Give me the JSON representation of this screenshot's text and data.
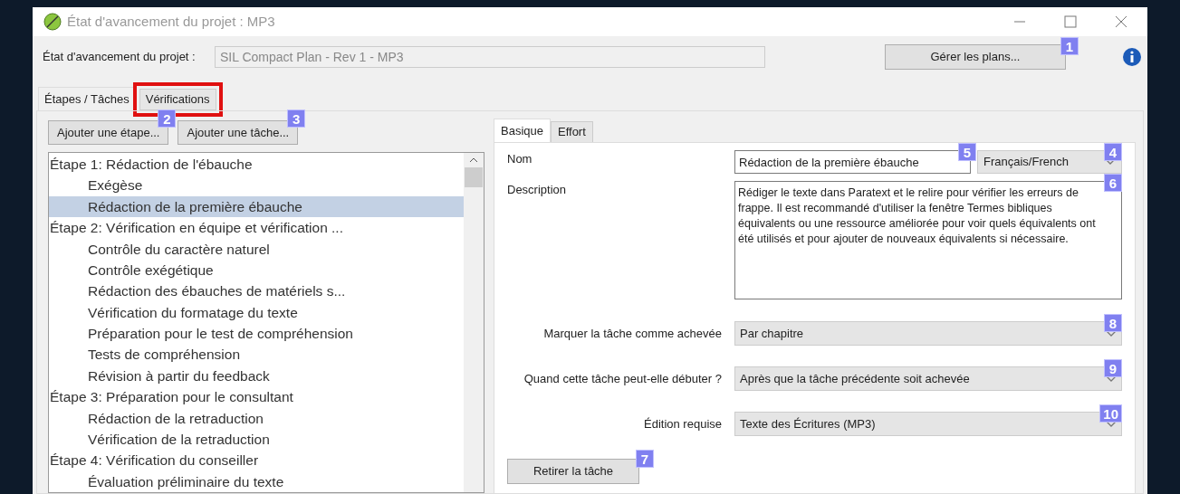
{
  "window": {
    "title": "État d'avancement du projet : MP3"
  },
  "plan": {
    "label": "État d'avancement du projet :",
    "value": "SIL Compact Plan - Rev 1 - MP3",
    "button": "Gérer les plans...",
    "button_callout": "1"
  },
  "tabs": [
    {
      "label": "Étapes / Tâches",
      "selected": true,
      "highlighted": false
    },
    {
      "label": "Vérifications",
      "selected": false,
      "highlighted": true
    }
  ],
  "actions": [
    {
      "label": "Ajouter une étape...",
      "callout": "2"
    },
    {
      "label": "Ajouter une tâche...",
      "callout": "3"
    }
  ],
  "tree": [
    {
      "label": "Étape 1: Rédaction de l'ébauche",
      "selected": false,
      "children": [
        {
          "label": "Exégèse",
          "selected": false
        },
        {
          "label": "Rédaction de la première ébauche",
          "selected": true
        }
      ]
    },
    {
      "label": "Étape 2: Vérification en équipe et vérification ...",
      "selected": false,
      "children": [
        {
          "label": "Contrôle du caractère naturel",
          "selected": false
        },
        {
          "label": "Contrôle exégétique",
          "selected": false
        },
        {
          "label": "Rédaction des ébauches de matériels s...",
          "selected": false
        },
        {
          "label": "Vérification du formatage du texte",
          "selected": false
        },
        {
          "label": "Préparation pour le test de compréhension",
          "selected": false
        },
        {
          "label": "Tests de compréhension",
          "selected": false
        },
        {
          "label": "Révision à partir du feedback",
          "selected": false
        }
      ]
    },
    {
      "label": "Étape 3: Préparation pour le consultant",
      "selected": false,
      "children": [
        {
          "label": "Rédaction de la retraduction",
          "selected": false
        },
        {
          "label": "Vérification de la retraduction",
          "selected": false
        }
      ]
    },
    {
      "label": "Étape 4: Vérification du conseiller",
      "selected": false,
      "children": [
        {
          "label": "Évaluation préliminaire du texte",
          "selected": false
        }
      ]
    }
  ],
  "detail_tabs": [
    {
      "label": "Basique",
      "selected": true
    },
    {
      "label": "Effort",
      "selected": false
    }
  ],
  "name": {
    "label": "Nom",
    "value": "Rédaction de la première ébauche",
    "callout": "5",
    "language": "Français/French",
    "language_callout": "4"
  },
  "description": {
    "label": "Description",
    "value": "Rédiger le texte dans Paratext et le relire pour vérifier les erreurs de frappe. Il est recommandé d'utiliser la fenêtre Termes bibliques équivalents ou une ressource améliorée pour voir quels équivalents ont été utilisés et pour ajouter de nouveaux équivalents si nécessaire.",
    "callout": "6"
  },
  "options": [
    {
      "label": "Marquer la tâche comme achevée",
      "value": "Par chapitre",
      "callout": "8"
    },
    {
      "label": "Quand cette tâche peut-elle débuter ?",
      "value": "Après que la tâche précédente soit achevée",
      "callout": "9"
    },
    {
      "label": "Édition requise",
      "value": "Texte des Écritures (MP3)",
      "callout": "10"
    }
  ],
  "remove": {
    "label": "Retirer la tâche",
    "callout": "7"
  }
}
